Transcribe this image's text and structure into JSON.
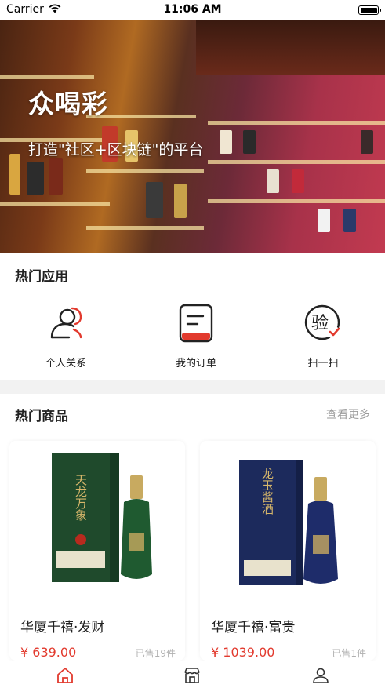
{
  "status_bar": {
    "carrier": "Carrier",
    "time": "11:06 AM"
  },
  "banner": {
    "title": "众喝彩",
    "subtitle": "打造\"社区+区块链\"的平台"
  },
  "hot_apps": {
    "title": "热门应用",
    "items": [
      {
        "label": "个人关系",
        "icon": "person-relations-icon"
      },
      {
        "label": "我的订单",
        "icon": "order-list-icon"
      },
      {
        "label": "扫一扫",
        "icon": "scan-verify-icon",
        "glyph": "验"
      }
    ]
  },
  "hot_products": {
    "title": "热门商品",
    "more": "查看更多",
    "items": [
      {
        "name": "华厦千禧·发财",
        "price": "¥ 639.00",
        "sold": "已售19件",
        "box_text": "天龙万象",
        "box_color": "#1f4a2c"
      },
      {
        "name": "华厦千禧·富贵",
        "price": "¥ 1039.00",
        "sold": "已售1件",
        "box_text": "龙玉酱酒",
        "box_color": "#1c2a5c"
      }
    ]
  },
  "tab_bar": {
    "items": [
      {
        "icon": "home-icon",
        "active": true
      },
      {
        "icon": "store-icon",
        "active": false
      },
      {
        "icon": "profile-icon",
        "active": false
      }
    ]
  },
  "colors": {
    "accent": "#e23a2e",
    "text": "#222222",
    "muted": "#9a9a9a",
    "page_bg": "#f2f2f2"
  }
}
